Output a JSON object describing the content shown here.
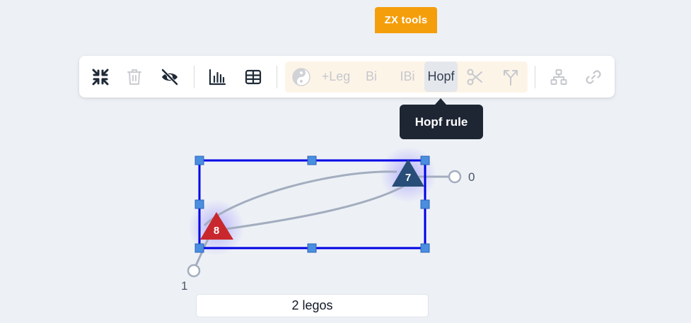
{
  "zx_tab": {
    "label": "ZX tools"
  },
  "toolbar": {
    "icons": {
      "collapse": "collapse-arrows-icon",
      "delete": "trash-icon",
      "hide": "eye-off-icon",
      "chart": "bar-chart-icon",
      "table": "table-icon",
      "yinyang": "yin-yang-icon",
      "scissors": "scissors-icon",
      "split": "split-arrows-icon",
      "network": "network-tree-icon",
      "link": "link-icon"
    },
    "zx_buttons": {
      "add_leg": "+Leg",
      "bi": "Bi",
      "ibi": "IBi",
      "hopf": "Hopf"
    }
  },
  "tooltip": {
    "text": "Hopf rule"
  },
  "canvas": {
    "nodes": [
      {
        "id": "8",
        "label": "8",
        "color": "#c8282d"
      },
      {
        "id": "7",
        "label": "7",
        "color": "#274d78"
      }
    ],
    "dangling_legs": [
      {
        "label": "0"
      },
      {
        "label": "1"
      }
    ],
    "selection_color": "#0000e6",
    "edge_color": "#a3adbf"
  },
  "status": {
    "legos_count_label": "2 legos"
  }
}
